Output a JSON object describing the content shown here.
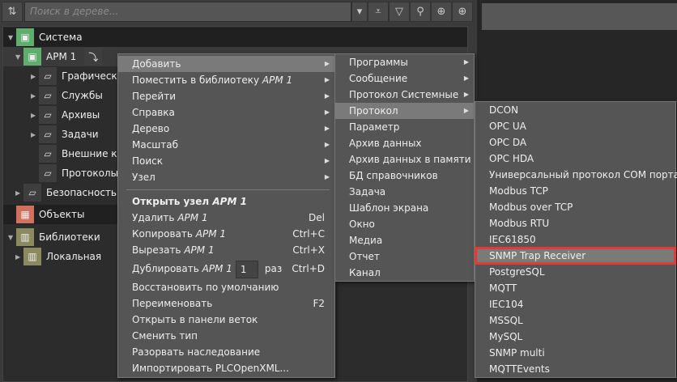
{
  "toolbar": {
    "search_placeholder": "Поиск в дереве..."
  },
  "tree": {
    "items": [
      {
        "label": "Система"
      },
      {
        "label": "АРМ 1"
      },
      {
        "label": "Графический"
      },
      {
        "label": "Службы"
      },
      {
        "label": "Архивы"
      },
      {
        "label": "Задачи"
      },
      {
        "label": "Внешние кана"
      },
      {
        "label": "Протоколы"
      },
      {
        "label": "Безопасность"
      },
      {
        "label": "Объекты"
      },
      {
        "label": "Библиотеки"
      },
      {
        "label": "Локальная"
      }
    ]
  },
  "context_menu": {
    "node": "АРМ 1",
    "items": [
      "Добавить",
      "Поместить в библиотеку",
      "Перейти",
      "Справка",
      "Дерево",
      "Масштаб",
      "Поиск",
      "Узел"
    ],
    "open": "Открыть узел",
    "delete": "Удалить",
    "delete_sc": "Del",
    "copy": "Копировать",
    "copy_sc": "Ctrl+C",
    "cut": "Вырезать",
    "cut_sc": "Ctrl+X",
    "dup": "Дублировать",
    "dup_value": "1",
    "dup_unit": "раз",
    "dup_sc": "Ctrl+D",
    "restore": "Восстановить по умолчанию",
    "rename": "Переименовать",
    "rename_sc": "F2",
    "open_branch": "Открыть в панели веток",
    "change_type": "Сменить тип",
    "break": "Разорвать наследование",
    "import": "Импортировать PLCOpenXML..."
  },
  "add_menu": {
    "items": [
      "Программы",
      "Сообщение",
      "Протокол Системные",
      "Протокол",
      "Параметр",
      "Архив данных",
      "Архив данных в памяти",
      "БД справочников",
      "Задача",
      "Шаблон экрана",
      "Окно",
      "Медиа",
      "Отчет",
      "Канал"
    ]
  },
  "protocol_menu": {
    "items": [
      "DCON",
      "OPC UA",
      "OPC DA",
      "OPC HDA",
      "Универсальный протокол COM порта",
      "Modbus TCP",
      "Modbus over TCP",
      "Modbus RTU",
      "IEC61850",
      "SNMP Trap Receiver",
      "PostgreSQL",
      "MQTT",
      "IEC104",
      "MSSQL",
      "MySQL",
      "SNMP multi",
      "MQTTEvents"
    ],
    "selected": "SNMP Trap Receiver"
  },
  "colors": {
    "highlight_outline": "#e53935",
    "system_icon": "#5fae6e",
    "objects_icon": "#d0705e",
    "library_icon": "#8a8a5e"
  }
}
